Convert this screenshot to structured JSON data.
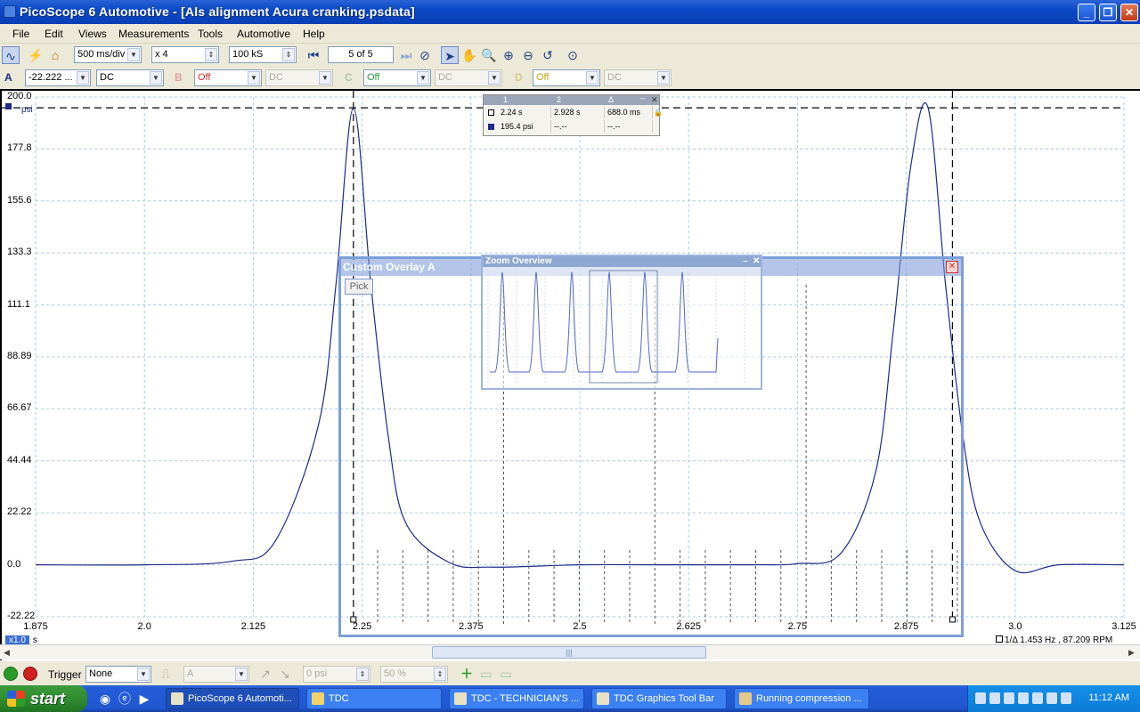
{
  "window": {
    "title": "PicoScope 6 Automotive - [Als alignment Acura cranking.psdata]",
    "minimize": "_",
    "restore": "❐",
    "close": "✕"
  },
  "menu": [
    "File",
    "Edit",
    "Views",
    "Measurements",
    "Tools",
    "Automotive",
    "Help"
  ],
  "toolbar": {
    "timebase": "500 ms/div",
    "zoom": "x 4",
    "samples": "100 kS",
    "page_indicator": "5 of 5"
  },
  "channels": {
    "a": {
      "label": "A",
      "range": "-22.222 ...",
      "coupling": "DC",
      "color": "#1f2a8a"
    },
    "b": {
      "label": "B",
      "range": "Off",
      "coupling": "DC",
      "color": "#c83232"
    },
    "c": {
      "label": "C",
      "range": "Off",
      "coupling": "DC",
      "color": "#2f9a3a"
    },
    "d": {
      "label": "D",
      "range": "Off",
      "coupling": "DC",
      "color": "#c9a21a"
    }
  },
  "scope": {
    "y_unit": "psi",
    "y_ticks": [
      "200.0",
      "177.8",
      "155.6",
      "133.3",
      "111.1",
      "88.89",
      "66.67",
      "44.44",
      "22.22",
      "0.0",
      "-22.22"
    ],
    "x_ticks": [
      "1.875",
      "2.0",
      "2.125",
      "2.25",
      "2.375",
      "2.5",
      "2.625",
      "2.75",
      "2.875",
      "3.0",
      "3.125"
    ],
    "x_unit": "s",
    "zoom_badge": "x1.0",
    "frequency_readout": "1.453 Hz , 87.209 RPM",
    "ruler_label": "1/Δ"
  },
  "chart_data": {
    "type": "line",
    "xlabel": "",
    "ylabel": "psi",
    "xlim": [
      1.875,
      3.125
    ],
    "ylim": [
      -22.22,
      200.0
    ],
    "series": [
      {
        "x": [
          1.875,
          2.0,
          2.1,
          2.15,
          2.2,
          2.22,
          2.24,
          2.26,
          2.28,
          2.3,
          2.35,
          2.4,
          2.5,
          2.6,
          2.7,
          2.75,
          2.8,
          2.84,
          2.86,
          2.88,
          2.9,
          2.92,
          2.94,
          2.96,
          3.0,
          3.05,
          3.125
        ],
        "y": [
          0.0,
          0.0,
          1.5,
          10.0,
          60.0,
          120.0,
          195.4,
          120.0,
          55.0,
          18.0,
          1.0,
          -1.0,
          0.0,
          0.0,
          0.0,
          0.5,
          5.0,
          40.0,
          100.0,
          170.0,
          195.4,
          120.0,
          55.0,
          18.0,
          -2.5,
          0.0,
          0.0
        ]
      }
    ],
    "threshold_line": 195.4,
    "cursor_lines_x": [
      2.24,
      2.928
    ]
  },
  "ruler_table": {
    "headers": [
      "1",
      "2",
      "Δ"
    ],
    "row_time": [
      "2.24 s",
      "2.928 s",
      "688.0 ms"
    ],
    "row_value": [
      "195.4 psi",
      "--.--",
      "--.--"
    ]
  },
  "overlay": {
    "title": "Custom Overlay A",
    "pick_label": "Pick",
    "close": "✕"
  },
  "zoom_overview": {
    "title": "Zoom Overview",
    "min": "–",
    "close": "✕"
  },
  "trigger": {
    "label": "Trigger",
    "mode": "None",
    "source": "A",
    "threshold": "0 psi",
    "position": "50 %"
  },
  "taskbar": {
    "start": "start",
    "tasks": [
      "PicoScope 6 Automoti...",
      "TDC",
      "TDC - TECHNICIAN'S ...",
      "TDC Graphics Tool Bar",
      "Running compression ..."
    ],
    "clock": "11:12 AM"
  }
}
